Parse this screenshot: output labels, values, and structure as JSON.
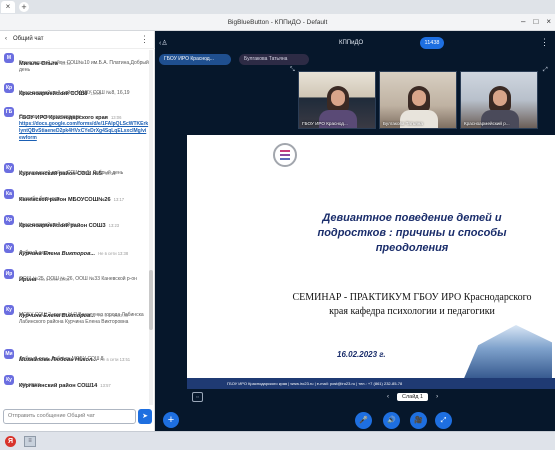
{
  "browser": {
    "tab_close": "×",
    "new_tab": "+",
    "window_title": "BigBlueButton - КППиДО - Default",
    "window_buttons": [
      "–",
      "□",
      "×"
    ]
  },
  "chat": {
    "back_glyph": "‹",
    "title": "Общий чат",
    "more_glyph": "⋮",
    "messages": [
      {
        "avatar": "М",
        "name": "Мигаль Ольга",
        "time": "13:12",
        "text": "Брюховецкий район СОШ№10 им.Б.А. Платина,Добрый день"
      },
      {
        "avatar": "Кр",
        "name": "Красноармейский СОШ8",
        "time": "13:06",
        "text": "Красноармейский район МАОУ СОШ №8, 16,19"
      },
      {
        "avatar": "ГБ",
        "name": "ГБОУ ИРО Краснодарского края",
        "time": "13:06",
        "text": "Ссылка на анкетирование:",
        "link": "https://docs.google.com/forms/d/e/1FAIpQLScWTKErkIyntQBvStiaeneD2pk4HVxCYeDrXg4SqLqELsxcIMg/viewform"
      },
      {
        "avatar": "Ку",
        "name": "Курганинский район СОШ №5",
        "time": "13:16",
        "text": "Курганинский район СОШ № 5, Добрый день"
      },
      {
        "avatar": "Ка",
        "name": "Каневской район МБОУСОШ№26",
        "time": "13:17",
        "text": "спасибо большое"
      },
      {
        "avatar": "Кр",
        "name": "Красноармейский район СОШ3",
        "time": "13:23",
        "text": "Красноармейский район"
      },
      {
        "avatar": "Ку",
        "name": "Курчина Елена Викторов...",
        "time": "Не в сети 13:38",
        "text": "Добрый день"
      },
      {
        "avatar": "Ир",
        "name": "Ирина",
        "time": "Не в сети 13:45",
        "text": "ООШ №25, ООШ № 26, ООШ №33 Каневской р-он"
      },
      {
        "avatar": "Ку",
        "name": "Курчина Елена Викторов...",
        "time": "Не в сети 13:48",
        "text": "МОБУ СОШ 2 имени Н.Я.Василенко города Лабинска Лабинского района Курчина Елена Викторовна"
      },
      {
        "avatar": "Ми",
        "name": "Михайлова Любовь Никол...",
        "time": "Не в сети 13:51",
        "text": "Добрый день,Лабинск,МОБУ СОШ 8"
      },
      {
        "avatar": "Ку",
        "name": "Курганинский район СОШ14",
        "time": "13:57",
        "text": "нет звука"
      }
    ],
    "composer_placeholder": "Отправить сообщение Общий чат",
    "send_glyph": "➤"
  },
  "meeting": {
    "users_glyph": "‹♙",
    "name": "КППиДО",
    "timer": "11438",
    "more_glyph": "⋮",
    "presenter_pills": [
      "ГБОУ ИРО Краснод...",
      "Булгакова Татьяна"
    ],
    "cameras": [
      {
        "label": "ГБОУ ИРО Краснод..."
      },
      {
        "label": "Булгакова Татьяна"
      },
      {
        "label": "Красноармейский р..."
      }
    ]
  },
  "slide": {
    "heading": "Девиантное поведение детей и подростков : причины и способы преодоления",
    "sub": "СЕМИНАР - ПРАКТИКУМ ГБОУ ИРО Краснодарского края кафедра психологии и педагогики",
    "date": "16.02.2023 г.",
    "footer": "ГБОУ ИРО Краснодарского края | www.iro23.ru | e-mail: post@iro23.ru | тел.: +7 (861) 232-85-78",
    "nav_prev": "‹",
    "nav_label": "Слайд 1",
    "nav_next": "›",
    "layout_label": "⇔"
  },
  "controls": {
    "plus": "+",
    "mic": "🎤",
    "audio": "🔊",
    "camera": "🎥",
    "screen": "⤢"
  },
  "taskbar": {
    "start_label": "Я",
    "file_glyph": "≡"
  }
}
